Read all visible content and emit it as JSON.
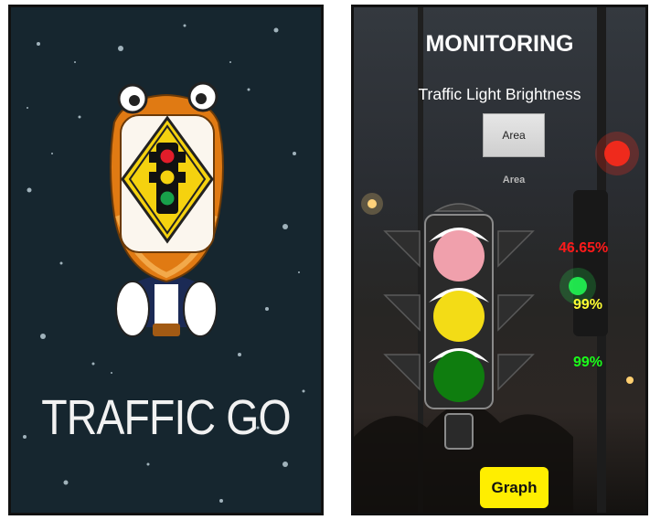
{
  "splash": {
    "title": "TRAFFIC GO",
    "background_color": "#16262f",
    "logo_icon": "tiger-traffic-light-mascot-icon"
  },
  "monitoring": {
    "title": "MONITORING",
    "subtitle": "Traffic Light Brightness",
    "area_button_label": "Area",
    "area_value": "Area",
    "lights": [
      {
        "color": "red",
        "fill": "#f0a0ac",
        "percent": "46.65%",
        "text_color": "#ff1a1a"
      },
      {
        "color": "yellow",
        "fill": "#f3dc16",
        "percent": "99%",
        "text_color": "#ffff33"
      },
      {
        "color": "green",
        "fill": "#0f7d0f",
        "percent": "99%",
        "text_color": "#1aff1a"
      }
    ],
    "graph_button_label": "Graph",
    "accent": "#ffee00"
  }
}
